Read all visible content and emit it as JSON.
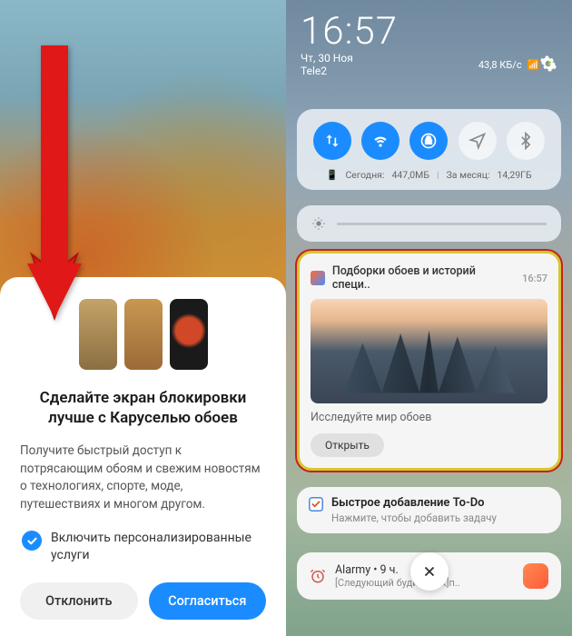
{
  "left": {
    "modal": {
      "title": "Сделайте экран блокировки лучше с Каруселью обоев",
      "description": "Получите быстрый доступ к потрясающим обоям и свежим новостям о технологиях, спорте, моде, путешествиях и многом другом.",
      "checkbox_label": "Включить персонализированные услуги",
      "decline_label": "Отклонить",
      "accept_label": "Согласиться"
    }
  },
  "right": {
    "status": {
      "time": "16:57",
      "date": "Чт, 30 Ноя",
      "carrier": "Tele2",
      "network_speed": "43,8 КБ/с"
    },
    "usage": {
      "today_label": "Сегодня:",
      "today_value": "447,0МБ",
      "month_label": "За месяц:",
      "month_value": "14,29ГБ"
    },
    "notifications": {
      "wallpaper": {
        "title": "Подборки обоев и историй специ..",
        "time": "16:57",
        "subtitle": "Исследуйте мир обоев",
        "open_label": "Открыть"
      },
      "todo": {
        "title": "Быстрое добавление To-Do",
        "subtitle": "Нажмите, чтобы добавить задачу"
      },
      "alarm": {
        "app": "Alarmy",
        "time_ago": "9 ч.",
        "subtitle": "[Следующий будильник]п.."
      }
    }
  }
}
